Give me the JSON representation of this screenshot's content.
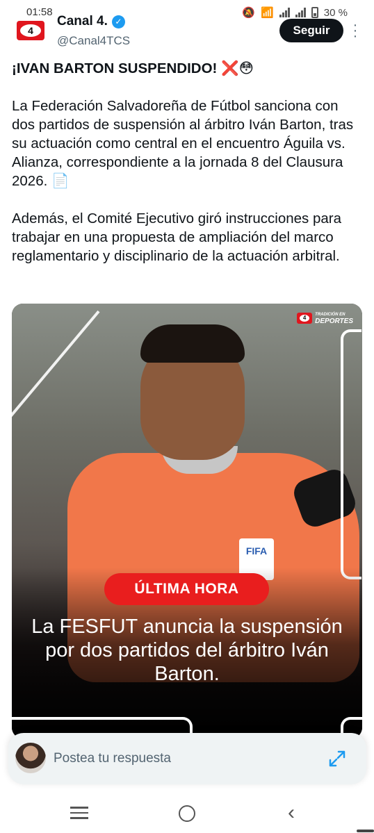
{
  "status_bar": {
    "time": "01:58",
    "battery": "30 %"
  },
  "tweet": {
    "author_name": "Canal 4.",
    "author_handle": "@Canal4TCS",
    "logo_text": "4",
    "follow_label": "Seguir",
    "title": "¡IVAN BARTON SUSPENDIDO!",
    "paragraph_1": "La Federación Salvadoreña de Fútbol sanciona con dos partidos de suspensión al árbitro Iván Barton, tras su actuación como central en el encuentro Águila vs. Alianza, correspondiente a la jornada 8 del Clausura 2026.",
    "paragraph_2": "Además, el Comité Ejecutivo giró instrucciones para trabajar en una propuesta de ampliación del marco reglamentario y disciplinario de la actuación arbitral."
  },
  "media": {
    "brand_line1": "TRADICIÓN EN",
    "brand_line2": "DEPORTES",
    "brand_logo_text": "4",
    "fifa_badge": "FIFA",
    "badge_label": "ÚLTIMA HORA",
    "headline": "La FESFUT anuncia la suspensión por dos partidos del árbitro Iván Barton."
  },
  "reply_bar": {
    "placeholder": "Postea tu respuesta"
  },
  "colors": {
    "follow_button": "#0f1419",
    "verified": "#1d9bf0",
    "badge_red": "#e91e1e",
    "brand_red": "#e0161e"
  }
}
